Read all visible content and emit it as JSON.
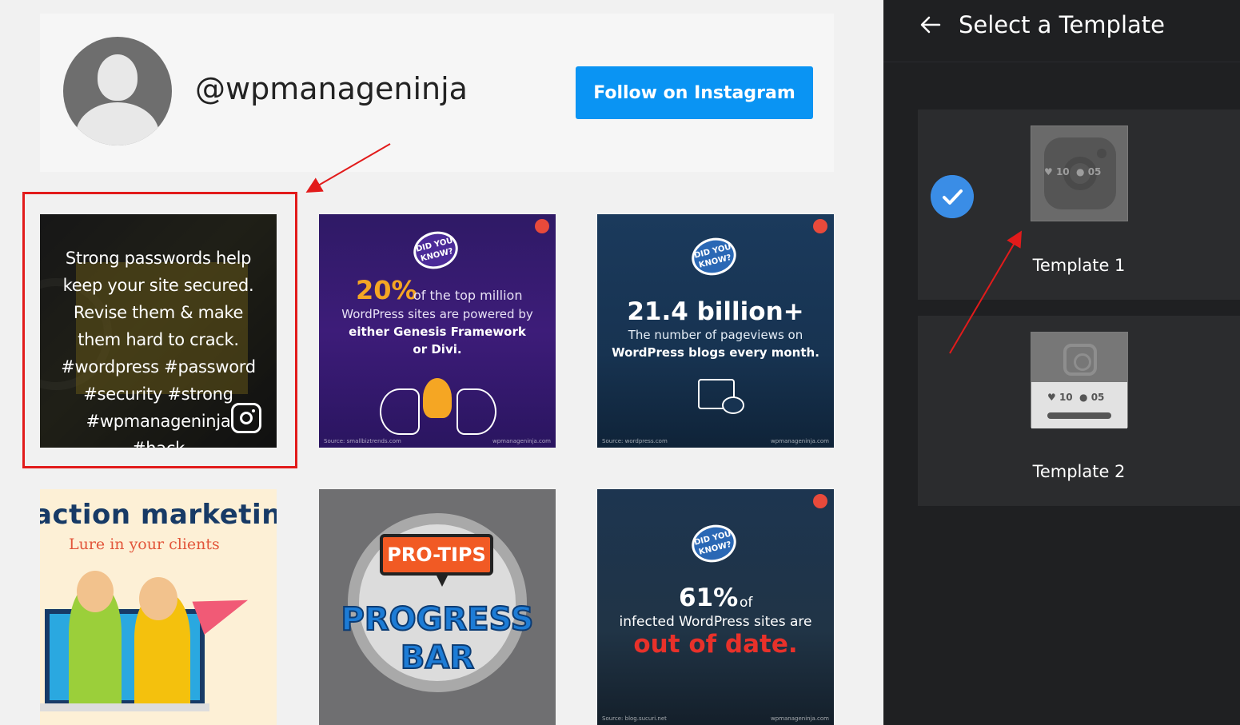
{
  "profile": {
    "username": "@wpmanageninja",
    "follow_label": "Follow on Instagram"
  },
  "feed": {
    "tile1": {
      "caption": "Strong passwords help keep your site secured. Revise them & make them hard to crack. #wordpress #password #security #strong #wpmanageninja #hack"
    },
    "tile2": {
      "badge": "DID YOU KNOW?",
      "big": "20%",
      "rest": "of the top million",
      "line1": "WordPress sites are powered by",
      "line2": "either Genesis Framework",
      "line3": "or Divi.",
      "source": "Source: smallbiztrends.com",
      "site": "wpmanageninja.com"
    },
    "tile3": {
      "badge": "DID YOU KNOW?",
      "big": "21.4 billion+",
      "line1": "The number of pageviews on",
      "line2": "WordPress blogs every month.",
      "source": "Source: wordpress.com",
      "site": "wpmanageninja.com"
    },
    "tile4": {
      "title": "action marketing",
      "subtitle": "Lure in your clients"
    },
    "tile5": {
      "bubble": "PRO-TIPS",
      "word1": "PROGRESS",
      "word2": "BAR"
    },
    "tile6": {
      "badge": "DID YOU KNOW?",
      "big": "61%",
      "of": "of",
      "line1": "infected WordPress sites are",
      "red": "out of date.",
      "source": "Source: blog.sucuri.net",
      "site": "wpmanageninja.com"
    }
  },
  "panel": {
    "title": "Select a Template",
    "templates": [
      {
        "label": "Template 1",
        "likes": "10",
        "comments": "05",
        "selected": true
      },
      {
        "label": "Template 2",
        "likes": "10",
        "comments": "05",
        "selected": false
      }
    ]
  },
  "colors": {
    "accent": "#0a94f3",
    "panel_bg": "#1f2022",
    "card_bg": "#2b2c2e",
    "check": "#3a8de6",
    "annotation": "#e21b1b"
  }
}
